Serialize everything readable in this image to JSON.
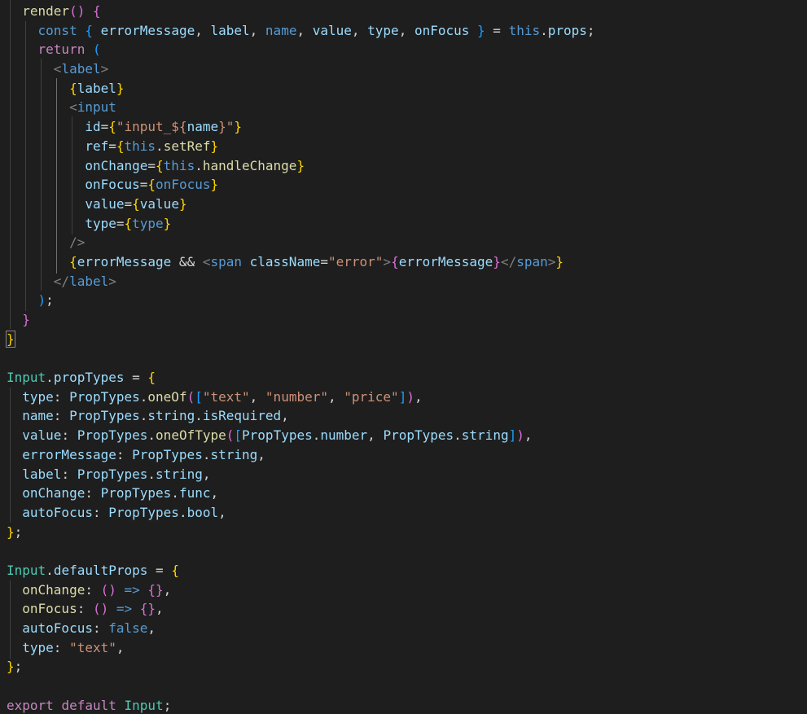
{
  "colors": {
    "background": "#1e1e1e",
    "default": "#d4d4d4",
    "keyword": "#569cd6",
    "control": "#c586c0",
    "variable": "#9cdcfe",
    "function": "#dcdcaa",
    "type": "#4ec9b0",
    "string": "#ce9178",
    "tag": "#808080",
    "bracket_gold": "#ffd700",
    "bracket_purple": "#da70d6",
    "bracket_blue": "#179fff"
  },
  "code_lines": [
    [
      {
        "t": "  ",
        "c": "default"
      },
      {
        "t": "render",
        "c": "function"
      },
      {
        "t": "() ",
        "c": "bracket_purple"
      },
      {
        "t": "{",
        "c": "bracket_purple"
      }
    ],
    [
      {
        "t": "    ",
        "c": "default"
      },
      {
        "t": "const",
        "c": "keyword"
      },
      {
        "t": " ",
        "c": "default"
      },
      {
        "t": "{",
        "c": "bracket_blue"
      },
      {
        "t": " errorMessage",
        "c": "variable"
      },
      {
        "t": ", ",
        "c": "default"
      },
      {
        "t": "label",
        "c": "variable"
      },
      {
        "t": ", ",
        "c": "default"
      },
      {
        "t": "name",
        "c": "keyword"
      },
      {
        "t": ", ",
        "c": "default"
      },
      {
        "t": "value",
        "c": "variable"
      },
      {
        "t": ", ",
        "c": "default"
      },
      {
        "t": "type",
        "c": "variable"
      },
      {
        "t": ", ",
        "c": "default"
      },
      {
        "t": "onFocus",
        "c": "variable"
      },
      {
        "t": " ",
        "c": "default"
      },
      {
        "t": "}",
        "c": "bracket_blue"
      },
      {
        "t": " = ",
        "c": "default"
      },
      {
        "t": "this",
        "c": "keyword"
      },
      {
        "t": ".",
        "c": "default"
      },
      {
        "t": "props",
        "c": "variable"
      },
      {
        "t": ";",
        "c": "default"
      }
    ],
    [
      {
        "t": "    ",
        "c": "default"
      },
      {
        "t": "return",
        "c": "control"
      },
      {
        "t": " ",
        "c": "default"
      },
      {
        "t": "(",
        "c": "bracket_blue"
      }
    ],
    [
      {
        "t": "      ",
        "c": "default"
      },
      {
        "t": "<",
        "c": "tag"
      },
      {
        "t": "label",
        "c": "keyword"
      },
      {
        "t": ">",
        "c": "tag"
      }
    ],
    [
      {
        "t": "        ",
        "c": "default"
      },
      {
        "t": "{",
        "c": "bracket_gold"
      },
      {
        "t": "label",
        "c": "variable"
      },
      {
        "t": "}",
        "c": "bracket_gold"
      }
    ],
    [
      {
        "t": "        ",
        "c": "default"
      },
      {
        "t": "<",
        "c": "tag"
      },
      {
        "t": "input",
        "c": "keyword"
      }
    ],
    [
      {
        "t": "          ",
        "c": "default"
      },
      {
        "t": "id",
        "c": "variable"
      },
      {
        "t": "=",
        "c": "default"
      },
      {
        "t": "{",
        "c": "bracket_gold"
      },
      {
        "t": "\"input_${",
        "c": "string"
      },
      {
        "t": "name",
        "c": "variable"
      },
      {
        "t": "}\"",
        "c": "string"
      },
      {
        "t": "}",
        "c": "bracket_gold"
      }
    ],
    [
      {
        "t": "          ",
        "c": "default"
      },
      {
        "t": "ref",
        "c": "variable"
      },
      {
        "t": "=",
        "c": "default"
      },
      {
        "t": "{",
        "c": "bracket_gold"
      },
      {
        "t": "this",
        "c": "keyword"
      },
      {
        "t": ".",
        "c": "default"
      },
      {
        "t": "setRef",
        "c": "function"
      },
      {
        "t": "}",
        "c": "bracket_gold"
      }
    ],
    [
      {
        "t": "          ",
        "c": "default"
      },
      {
        "t": "onChange",
        "c": "variable"
      },
      {
        "t": "=",
        "c": "default"
      },
      {
        "t": "{",
        "c": "bracket_gold"
      },
      {
        "t": "this",
        "c": "keyword"
      },
      {
        "t": ".",
        "c": "default"
      },
      {
        "t": "handleChange",
        "c": "function"
      },
      {
        "t": "}",
        "c": "bracket_gold"
      }
    ],
    [
      {
        "t": "          ",
        "c": "default"
      },
      {
        "t": "onFocus",
        "c": "variable"
      },
      {
        "t": "=",
        "c": "default"
      },
      {
        "t": "{",
        "c": "bracket_gold"
      },
      {
        "t": "onFocus",
        "c": "keyword"
      },
      {
        "t": "}",
        "c": "bracket_gold"
      }
    ],
    [
      {
        "t": "          ",
        "c": "default"
      },
      {
        "t": "value",
        "c": "variable"
      },
      {
        "t": "=",
        "c": "default"
      },
      {
        "t": "{",
        "c": "bracket_gold"
      },
      {
        "t": "value",
        "c": "variable"
      },
      {
        "t": "}",
        "c": "bracket_gold"
      }
    ],
    [
      {
        "t": "          ",
        "c": "default"
      },
      {
        "t": "type",
        "c": "variable"
      },
      {
        "t": "=",
        "c": "default"
      },
      {
        "t": "{",
        "c": "bracket_gold"
      },
      {
        "t": "type",
        "c": "keyword"
      },
      {
        "t": "}",
        "c": "bracket_gold"
      }
    ],
    [
      {
        "t": "        ",
        "c": "default"
      },
      {
        "t": "/>",
        "c": "tag"
      }
    ],
    [
      {
        "t": "        ",
        "c": "default"
      },
      {
        "t": "{",
        "c": "bracket_gold"
      },
      {
        "t": "errorMessage",
        "c": "variable"
      },
      {
        "t": " && ",
        "c": "default"
      },
      {
        "t": "<",
        "c": "tag"
      },
      {
        "t": "span",
        "c": "keyword"
      },
      {
        "t": " ",
        "c": "default"
      },
      {
        "t": "className",
        "c": "variable"
      },
      {
        "t": "=",
        "c": "default"
      },
      {
        "t": "\"error\"",
        "c": "string"
      },
      {
        "t": ">",
        "c": "tag"
      },
      {
        "t": "{",
        "c": "bracket_purple"
      },
      {
        "t": "errorMessage",
        "c": "variable"
      },
      {
        "t": "}",
        "c": "bracket_purple"
      },
      {
        "t": "</",
        "c": "tag"
      },
      {
        "t": "span",
        "c": "keyword"
      },
      {
        "t": ">",
        "c": "tag"
      },
      {
        "t": "}",
        "c": "bracket_gold"
      }
    ],
    [
      {
        "t": "      ",
        "c": "default"
      },
      {
        "t": "</",
        "c": "tag"
      },
      {
        "t": "label",
        "c": "keyword"
      },
      {
        "t": ">",
        "c": "tag"
      }
    ],
    [
      {
        "t": "    ",
        "c": "default"
      },
      {
        "t": ")",
        "c": "bracket_blue"
      },
      {
        "t": ";",
        "c": "default"
      }
    ],
    [
      {
        "t": "  ",
        "c": "default"
      },
      {
        "t": "}",
        "c": "bracket_purple"
      }
    ],
    [
      {
        "t": "}",
        "c": "bracket_gold"
      }
    ],
    [
      {
        "t": "",
        "c": "default"
      }
    ],
    [
      {
        "t": "Input",
        "c": "type"
      },
      {
        "t": ".",
        "c": "default"
      },
      {
        "t": "propTypes",
        "c": "variable"
      },
      {
        "t": " = ",
        "c": "default"
      },
      {
        "t": "{",
        "c": "bracket_gold"
      }
    ],
    [
      {
        "t": "  ",
        "c": "default"
      },
      {
        "t": "type",
        "c": "variable"
      },
      {
        "t": ": ",
        "c": "default"
      },
      {
        "t": "PropTypes",
        "c": "variable"
      },
      {
        "t": ".",
        "c": "default"
      },
      {
        "t": "oneOf",
        "c": "function"
      },
      {
        "t": "(",
        "c": "bracket_purple"
      },
      {
        "t": "[",
        "c": "bracket_blue"
      },
      {
        "t": "\"text\"",
        "c": "string"
      },
      {
        "t": ", ",
        "c": "default"
      },
      {
        "t": "\"number\"",
        "c": "string"
      },
      {
        "t": ", ",
        "c": "default"
      },
      {
        "t": "\"price\"",
        "c": "string"
      },
      {
        "t": "]",
        "c": "bracket_blue"
      },
      {
        "t": ")",
        "c": "bracket_purple"
      },
      {
        "t": ",",
        "c": "default"
      }
    ],
    [
      {
        "t": "  ",
        "c": "default"
      },
      {
        "t": "name",
        "c": "variable"
      },
      {
        "t": ": ",
        "c": "default"
      },
      {
        "t": "PropTypes",
        "c": "variable"
      },
      {
        "t": ".",
        "c": "default"
      },
      {
        "t": "string",
        "c": "variable"
      },
      {
        "t": ".",
        "c": "default"
      },
      {
        "t": "isRequired",
        "c": "variable"
      },
      {
        "t": ",",
        "c": "default"
      }
    ],
    [
      {
        "t": "  ",
        "c": "default"
      },
      {
        "t": "value",
        "c": "variable"
      },
      {
        "t": ": ",
        "c": "default"
      },
      {
        "t": "PropTypes",
        "c": "variable"
      },
      {
        "t": ".",
        "c": "default"
      },
      {
        "t": "oneOfType",
        "c": "function"
      },
      {
        "t": "(",
        "c": "bracket_purple"
      },
      {
        "t": "[",
        "c": "bracket_blue"
      },
      {
        "t": "PropTypes",
        "c": "variable"
      },
      {
        "t": ".",
        "c": "default"
      },
      {
        "t": "number",
        "c": "variable"
      },
      {
        "t": ", ",
        "c": "default"
      },
      {
        "t": "PropTypes",
        "c": "variable"
      },
      {
        "t": ".",
        "c": "default"
      },
      {
        "t": "string",
        "c": "variable"
      },
      {
        "t": "]",
        "c": "bracket_blue"
      },
      {
        "t": ")",
        "c": "bracket_purple"
      },
      {
        "t": ",",
        "c": "default"
      }
    ],
    [
      {
        "t": "  ",
        "c": "default"
      },
      {
        "t": "errorMessage",
        "c": "variable"
      },
      {
        "t": ": ",
        "c": "default"
      },
      {
        "t": "PropTypes",
        "c": "variable"
      },
      {
        "t": ".",
        "c": "default"
      },
      {
        "t": "string",
        "c": "variable"
      },
      {
        "t": ",",
        "c": "default"
      }
    ],
    [
      {
        "t": "  ",
        "c": "default"
      },
      {
        "t": "label",
        "c": "variable"
      },
      {
        "t": ": ",
        "c": "default"
      },
      {
        "t": "PropTypes",
        "c": "variable"
      },
      {
        "t": ".",
        "c": "default"
      },
      {
        "t": "string",
        "c": "variable"
      },
      {
        "t": ",",
        "c": "default"
      }
    ],
    [
      {
        "t": "  ",
        "c": "default"
      },
      {
        "t": "onChange",
        "c": "variable"
      },
      {
        "t": ": ",
        "c": "default"
      },
      {
        "t": "PropTypes",
        "c": "variable"
      },
      {
        "t": ".",
        "c": "default"
      },
      {
        "t": "func",
        "c": "variable"
      },
      {
        "t": ",",
        "c": "default"
      }
    ],
    [
      {
        "t": "  ",
        "c": "default"
      },
      {
        "t": "autoFocus",
        "c": "variable"
      },
      {
        "t": ": ",
        "c": "default"
      },
      {
        "t": "PropTypes",
        "c": "variable"
      },
      {
        "t": ".",
        "c": "default"
      },
      {
        "t": "bool",
        "c": "variable"
      },
      {
        "t": ",",
        "c": "default"
      }
    ],
    [
      {
        "t": "}",
        "c": "bracket_gold"
      },
      {
        "t": ";",
        "c": "default"
      }
    ],
    [
      {
        "t": "",
        "c": "default"
      }
    ],
    [
      {
        "t": "Input",
        "c": "type"
      },
      {
        "t": ".",
        "c": "default"
      },
      {
        "t": "defaultProps",
        "c": "variable"
      },
      {
        "t": " = ",
        "c": "default"
      },
      {
        "t": "{",
        "c": "bracket_gold"
      }
    ],
    [
      {
        "t": "  ",
        "c": "default"
      },
      {
        "t": "onChange",
        "c": "function"
      },
      {
        "t": ": ",
        "c": "default"
      },
      {
        "t": "()",
        "c": "bracket_purple"
      },
      {
        "t": " => ",
        "c": "keyword"
      },
      {
        "t": "{}",
        "c": "bracket_purple"
      },
      {
        "t": ",",
        "c": "default"
      }
    ],
    [
      {
        "t": "  ",
        "c": "default"
      },
      {
        "t": "onFocus",
        "c": "function"
      },
      {
        "t": ": ",
        "c": "default"
      },
      {
        "t": "()",
        "c": "bracket_purple"
      },
      {
        "t": " => ",
        "c": "keyword"
      },
      {
        "t": "{}",
        "c": "bracket_purple"
      },
      {
        "t": ",",
        "c": "default"
      }
    ],
    [
      {
        "t": "  ",
        "c": "default"
      },
      {
        "t": "autoFocus",
        "c": "variable"
      },
      {
        "t": ": ",
        "c": "default"
      },
      {
        "t": "false",
        "c": "keyword"
      },
      {
        "t": ",",
        "c": "default"
      }
    ],
    [
      {
        "t": "  ",
        "c": "default"
      },
      {
        "t": "type",
        "c": "variable"
      },
      {
        "t": ": ",
        "c": "default"
      },
      {
        "t": "\"text\"",
        "c": "string"
      },
      {
        "t": ",",
        "c": "default"
      }
    ],
    [
      {
        "t": "}",
        "c": "bracket_gold"
      },
      {
        "t": ";",
        "c": "default"
      }
    ],
    [
      {
        "t": "",
        "c": "default"
      }
    ],
    [
      {
        "t": "export",
        "c": "control"
      },
      {
        "t": " ",
        "c": "default"
      },
      {
        "t": "default",
        "c": "control"
      },
      {
        "t": " ",
        "c": "default"
      },
      {
        "t": "Input",
        "c": "type"
      },
      {
        "t": ";",
        "c": "default"
      }
    ]
  ]
}
